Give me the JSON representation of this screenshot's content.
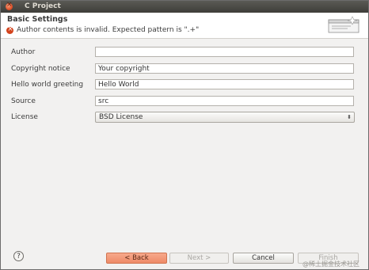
{
  "window": {
    "title": "C Project"
  },
  "header": {
    "title": "Basic Settings",
    "error_message": "Author contents is invalid.  Expected pattern is \".+\""
  },
  "form": {
    "fields": [
      {
        "label": "Author",
        "value": ""
      },
      {
        "label": "Copyright notice",
        "value": "Your copyright"
      },
      {
        "label": "Hello world greeting",
        "value": "Hello World"
      },
      {
        "label": "Source",
        "value": "src"
      }
    ],
    "license": {
      "label": "License",
      "selected": "BSD License",
      "arrow": "⬍"
    }
  },
  "buttons": {
    "help": "?",
    "back": "< Back",
    "next": "Next >",
    "cancel": "Cancel",
    "finish": "Finish"
  },
  "watermark": "@稀土掘金技术社区",
  "colors": {
    "accent": "#ee8a67",
    "error": "#d3431c",
    "titlebar": "#3e3d39"
  }
}
